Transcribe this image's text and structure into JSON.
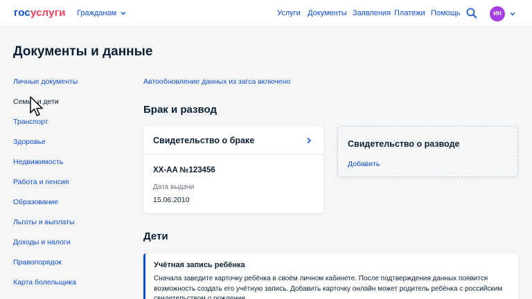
{
  "header": {
    "logo_part1": "гос",
    "logo_part2": "услуги",
    "audience": "Гражданам",
    "nav": [
      "Услуги",
      "Документы",
      "Заявления",
      "Платежи",
      "Помощь"
    ],
    "avatar_initials": "ИН",
    "icons": {
      "search": "search-icon",
      "audience_chevron": "chevron-down-icon",
      "avatar_chevron": "chevron-down-icon"
    }
  },
  "page": {
    "title": "Документы и данные"
  },
  "sidebar": {
    "items": [
      {
        "label": "Личные документы"
      },
      {
        "label": "Семья и дети"
      },
      {
        "label": "Транспорт"
      },
      {
        "label": "Здоровье"
      },
      {
        "label": "Недвижимость"
      },
      {
        "label": "Работа и пенсия"
      },
      {
        "label": "Образование"
      },
      {
        "label": "Льготы и выплаты"
      },
      {
        "label": "Доходы и налоги"
      },
      {
        "label": "Правопорядок"
      },
      {
        "label": "Карта болельщика"
      }
    ],
    "active_index": 1
  },
  "main": {
    "autoupdate": "Автообновление данных из загса включено",
    "marriage_heading": "Брак и развод",
    "marriage_card": {
      "title": "Свидетельство о браке",
      "number": "XX-AA №123456",
      "issue_label": "Дата выдачи",
      "issue_date": "15.06.2010"
    },
    "divorce_card": {
      "title": "Свидетельство о разводе",
      "add_label": "Добавить"
    },
    "children_heading": "Дети",
    "child_notice": {
      "title": "Учётная запись ребёнка",
      "text": "Сначала заведите карточку ребёнка в своём личном кабинете. После подтверждения данных появится возможность создать его учётную запись. Добавить карточку онлайн может родитель ребёнка с российским свидетельством о рождении"
    }
  },
  "colors": {
    "accent": "#0d4cd3",
    "logo_red": "#ee3f58",
    "avatar": "#a43ee0",
    "text": "#0b1f33",
    "background": "#f5f6f8"
  }
}
